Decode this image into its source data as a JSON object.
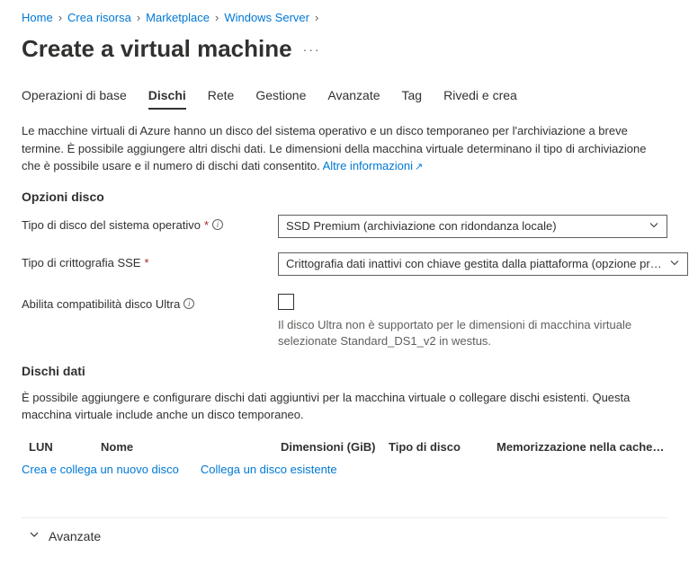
{
  "breadcrumb": [
    {
      "label": "Home"
    },
    {
      "label": "Crea risorsa"
    },
    {
      "label": "Marketplace"
    },
    {
      "label": "Windows Server"
    }
  ],
  "page_title": "Create a virtual machine",
  "tabs": [
    {
      "label": "Operazioni di base"
    },
    {
      "label": "Dischi"
    },
    {
      "label": "Rete"
    },
    {
      "label": "Gestione"
    },
    {
      "label": "Avanzate"
    },
    {
      "label": "Tag"
    },
    {
      "label": "Rivedi e crea"
    }
  ],
  "intro_text": "Le macchine virtuali di Azure hanno un disco del sistema operativo e un disco temporaneo per l'archiviazione a breve termine. È possibile aggiungere altri dischi dati. Le dimensioni della macchina virtuale determinano il tipo di archiviazione che è possibile usare e il numero di dischi dati consentito. ",
  "intro_link": "Altre informazioni",
  "sections": {
    "disk_options": "Opzioni disco",
    "data_disks": "Dischi dati"
  },
  "fields": {
    "os_disk_type": {
      "label": "Tipo di disco del sistema operativo",
      "value": "SSD Premium (archiviazione con ridondanza locale)"
    },
    "sse_encryption": {
      "label": "Tipo di crittografia SSE",
      "value": "Crittografia dati inattivi con chiave gestita dalla piattaforma (opzione pr…"
    },
    "ultra_compat": {
      "label": "Abilita compatibilità disco Ultra",
      "hint": "Il disco Ultra non è supportato per le dimensioni di macchina virtuale selezionate Standard_DS1_v2 in westus."
    }
  },
  "data_disks_desc": "È possibile aggiungere e configurare dischi dati aggiuntivi per la macchina virtuale o collegare dischi esistenti. Questa macchina virtuale include anche un disco temporaneo.",
  "table": {
    "lun": "LUN",
    "nome": "Nome",
    "dim": "Dimensioni (GiB)",
    "tipo": "Tipo di disco",
    "cache": "Memorizzazione nella cache de…"
  },
  "links": {
    "create_attach": "Crea e collega un nuovo disco",
    "attach_existing": "Collega un disco esistente"
  },
  "accordion": {
    "advanced": "Avanzate"
  }
}
